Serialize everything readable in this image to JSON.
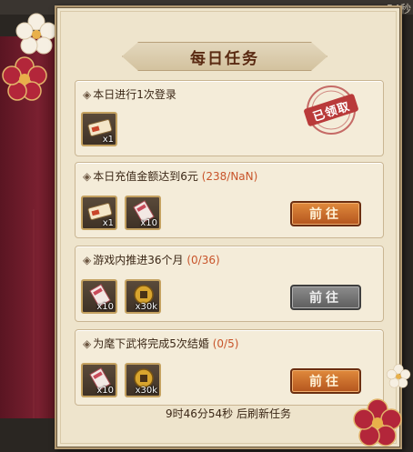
{
  "timer_corner": "54秒",
  "title": "每日任务",
  "tasks": [
    {
      "title": "本日进行1次登录",
      "progress": "",
      "rewards": [
        {
          "icon": "ticket-icon",
          "qty": "x1"
        }
      ],
      "status": "已领取"
    },
    {
      "title": "本日充值金额达到6元",
      "progress": "(238/NaN)",
      "rewards": [
        {
          "icon": "ticket-icon",
          "qty": "x1"
        },
        {
          "icon": "scroll-icon",
          "qty": "x10"
        }
      ],
      "button": "前往",
      "button_state": "active"
    },
    {
      "title": "游戏内推进36个月",
      "progress": "(0/36)",
      "rewards": [
        {
          "icon": "scroll-icon",
          "qty": "x10"
        },
        {
          "icon": "coin-icon",
          "qty": "x30k"
        }
      ],
      "button": "前往",
      "button_state": "disabled"
    },
    {
      "title": "为麾下武将完成5次结婚",
      "progress": "(0/5)",
      "rewards": [
        {
          "icon": "scroll-icon",
          "qty": "x10"
        },
        {
          "icon": "coin-icon",
          "qty": "x30k"
        }
      ],
      "button": "前往",
      "button_state": "active"
    }
  ],
  "footer": "9时46分54秒 后刷新任务",
  "colors": {
    "panel": "#eee4cc",
    "accent_button": "#c8682a",
    "progress": "#c8542a",
    "sash": "#7a2030"
  }
}
